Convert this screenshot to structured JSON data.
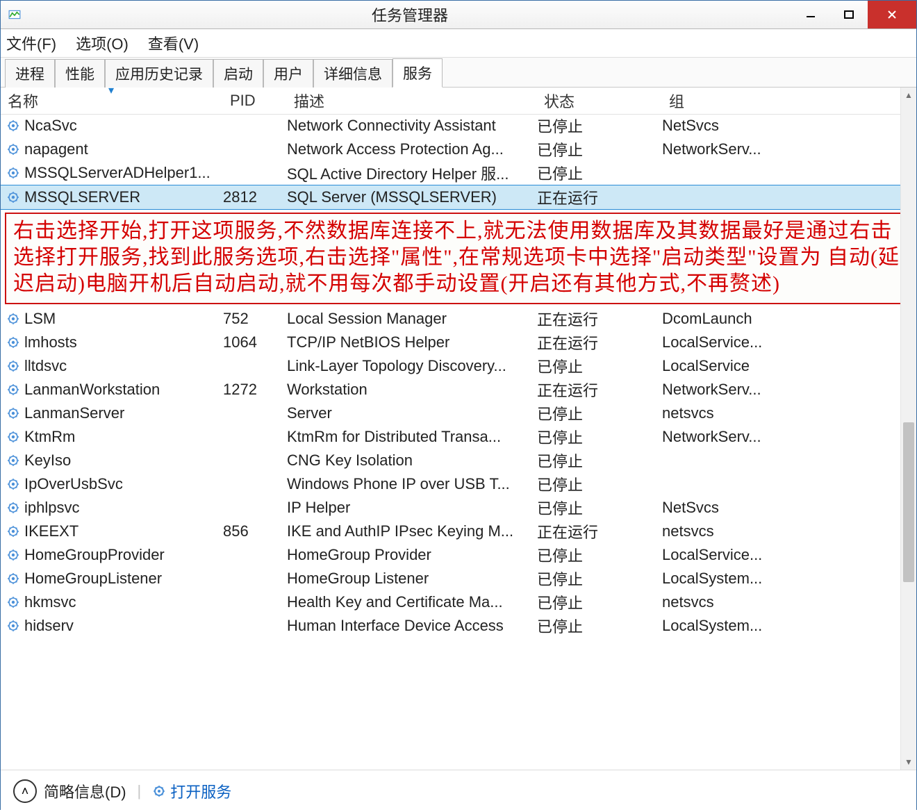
{
  "window": {
    "title": "任务管理器"
  },
  "menu": {
    "file": "文件(F)",
    "options": "选项(O)",
    "view": "查看(V)"
  },
  "tabs": [
    "进程",
    "性能",
    "应用历史记录",
    "启动",
    "用户",
    "详细信息",
    "服务"
  ],
  "active_tab": 6,
  "columns": {
    "name": "名称",
    "pid": "PID",
    "desc": "描述",
    "status": "状态",
    "group": "组"
  },
  "rows_top": [
    {
      "name": "NcaSvc",
      "pid": "",
      "desc": "Network Connectivity Assistant",
      "status": "已停止",
      "group": "NetSvcs"
    },
    {
      "name": "napagent",
      "pid": "",
      "desc": "Network Access Protection Ag...",
      "status": "已停止",
      "group": "NetworkServ..."
    },
    {
      "name": "MSSQLServerADHelper1...",
      "pid": "",
      "desc": "SQL Active Directory Helper 服...",
      "status": "已停止",
      "group": ""
    },
    {
      "name": "MSSQLSERVER",
      "pid": "2812",
      "desc": "SQL Server (MSSQLSERVER)",
      "status": "正在运行",
      "group": ""
    }
  ],
  "selected_index": 3,
  "annotation": "右击选择开始,打开这项服务,不然数据库连接不上,就无法使用数据库及其数据最好是通过右击选择打开服务,找到此服务选项,右击选择\"属性\",在常规选项卡中选择\"启动类型\"设置为 自动(延迟启动)电脑开机后自动启动,就不用每次都手动设置(开启还有其他方式,不再赘述)",
  "rows_bottom": [
    {
      "name": "LSM",
      "pid": "752",
      "desc": "Local Session Manager",
      "status": "正在运行",
      "group": "DcomLaunch"
    },
    {
      "name": "lmhosts",
      "pid": "1064",
      "desc": "TCP/IP NetBIOS Helper",
      "status": "正在运行",
      "group": "LocalService..."
    },
    {
      "name": "lltdsvc",
      "pid": "",
      "desc": "Link-Layer Topology Discovery...",
      "status": "已停止",
      "group": "LocalService"
    },
    {
      "name": "LanmanWorkstation",
      "pid": "1272",
      "desc": "Workstation",
      "status": "正在运行",
      "group": "NetworkServ..."
    },
    {
      "name": "LanmanServer",
      "pid": "",
      "desc": "Server",
      "status": "已停止",
      "group": "netsvcs"
    },
    {
      "name": "KtmRm",
      "pid": "",
      "desc": "KtmRm for Distributed Transa...",
      "status": "已停止",
      "group": "NetworkServ..."
    },
    {
      "name": "KeyIso",
      "pid": "",
      "desc": "CNG Key Isolation",
      "status": "已停止",
      "group": ""
    },
    {
      "name": "IpOverUsbSvc",
      "pid": "",
      "desc": "Windows Phone IP over USB T...",
      "status": "已停止",
      "group": ""
    },
    {
      "name": "iphlpsvc",
      "pid": "",
      "desc": "IP Helper",
      "status": "已停止",
      "group": "NetSvcs"
    },
    {
      "name": "IKEEXT",
      "pid": "856",
      "desc": "IKE and AuthIP IPsec Keying M...",
      "status": "正在运行",
      "group": "netsvcs"
    },
    {
      "name": "HomeGroupProvider",
      "pid": "",
      "desc": "HomeGroup Provider",
      "status": "已停止",
      "group": "LocalService..."
    },
    {
      "name": "HomeGroupListener",
      "pid": "",
      "desc": "HomeGroup Listener",
      "status": "已停止",
      "group": "LocalSystem..."
    },
    {
      "name": "hkmsvc",
      "pid": "",
      "desc": "Health Key and Certificate Ma...",
      "status": "已停止",
      "group": "netsvcs"
    },
    {
      "name": "hidserv",
      "pid": "",
      "desc": "Human Interface Device Access",
      "status": "已停止",
      "group": "LocalSystem..."
    }
  ],
  "statusbar": {
    "brief": "简略信息(D)",
    "open_services": "打开服务"
  }
}
